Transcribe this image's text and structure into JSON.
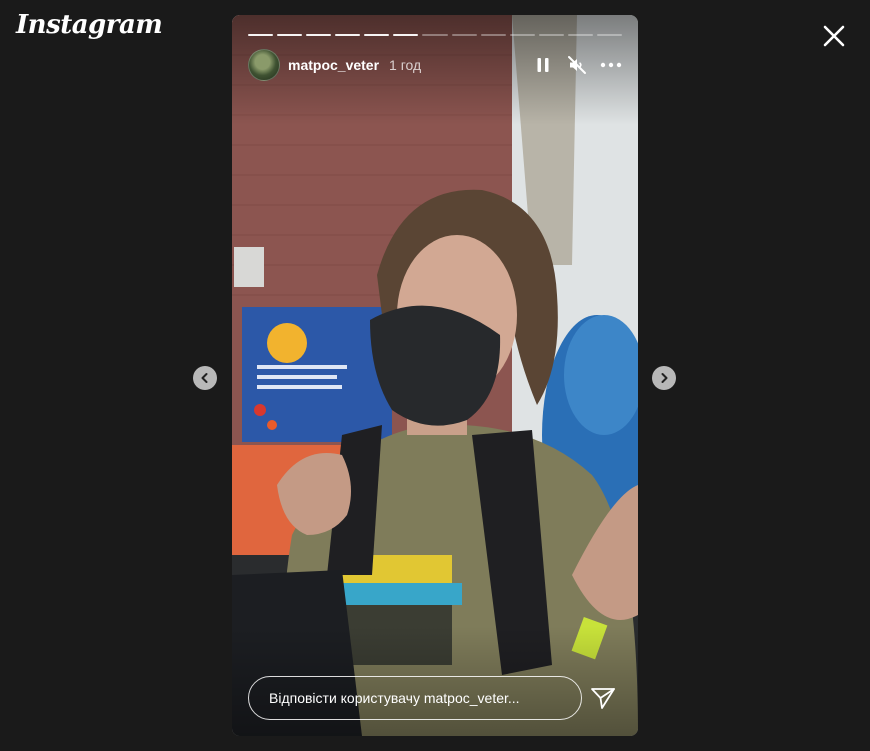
{
  "app": {
    "logo_text": "Instagram"
  },
  "story": {
    "username": "matpoc_veter",
    "time_ago": "1 год",
    "progress": {
      "segments_total": 13,
      "segments_seen": 6
    },
    "reply": {
      "placeholder": "Відповісти користувачу matpoc_veter..."
    }
  },
  "icons": {
    "close": "close-icon",
    "pause": "pause-icon",
    "mute": "speaker-muted-icon",
    "more": "more-options-icon",
    "send": "paper-plane-icon",
    "prev": "chevron-left-icon",
    "next": "chevron-right-icon"
  },
  "colors": {
    "background": "#1a1a1a",
    "text": "#ffffff"
  }
}
